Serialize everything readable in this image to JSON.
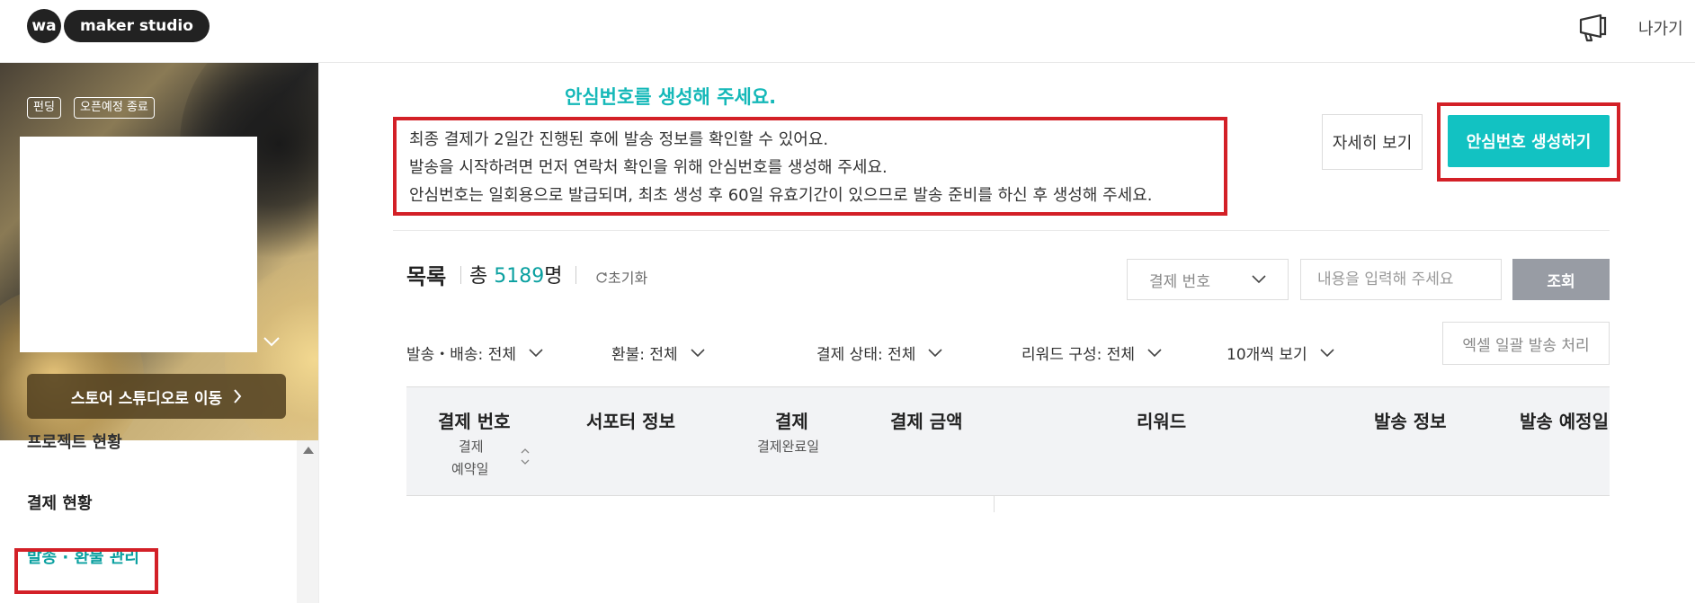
{
  "header": {
    "logo_wa": "wa",
    "logo_maker": "maker studio",
    "exit_label": "나가기"
  },
  "sidebar": {
    "tags": [
      "펀딩",
      "오픈예정 종료"
    ],
    "store_button": "스토어 스튜디오로 이동",
    "menu": [
      {
        "label": "프로젝트 현황"
      },
      {
        "label": "결제 현황"
      },
      {
        "label": "발송 · 환불 관리"
      }
    ]
  },
  "notice": {
    "title": "안심번호를 생성해 주세요.",
    "lines": [
      "최종 결제가 2일간 진행된 후에 발송 정보를 확인할 수 있어요.",
      "발송을 시작하려면 먼저 연락처 확인을 위해 안심번호를 생성해 주세요.",
      "안심번호는 일회용으로 발급되며, 최초 생성 후 60일 유효기간이 있으므로 발송 준비를 하신 후 생성해 주세요."
    ],
    "detail_button": "자세히 보기",
    "create_button": "안심번호 생성하기"
  },
  "list": {
    "title": "목록",
    "count_prefix": "총 ",
    "count": "5189",
    "count_suffix": "명",
    "reset_label": "초기화"
  },
  "search": {
    "select_value": "결제 번호",
    "placeholder": "내용을 입력해 주세요",
    "button": "조회"
  },
  "filters": [
    {
      "label": "발송・배송: 전체"
    },
    {
      "label": "환불: 전체"
    },
    {
      "label": "결제 상태: 전체"
    },
    {
      "label": "리워드 구성: 전체"
    },
    {
      "label": "10개씩 보기"
    }
  ],
  "excel_button": "엑셀 일괄 발송 처리",
  "table": {
    "headers": [
      {
        "label": "결제 번호",
        "sub": [
          "결제",
          "예약일"
        ]
      },
      {
        "label": "서포터 정보"
      },
      {
        "label": "결제",
        "sub": [
          "결제완료일"
        ]
      },
      {
        "label": "결제 금액"
      },
      {
        "label": "리워드"
      },
      {
        "label": "발송 정보"
      },
      {
        "label": "발송 예정일"
      }
    ]
  },
  "colors": {
    "accent": "#12c2c2",
    "accent_text": "#0aa0a0",
    "highlight_border": "#d32027",
    "search_button": "#989ca4"
  },
  "icons": [
    "megaphone-icon",
    "chevron-down-icon",
    "chevron-right-icon",
    "refresh-icon",
    "sort-icon",
    "scroll-up-icon"
  ]
}
